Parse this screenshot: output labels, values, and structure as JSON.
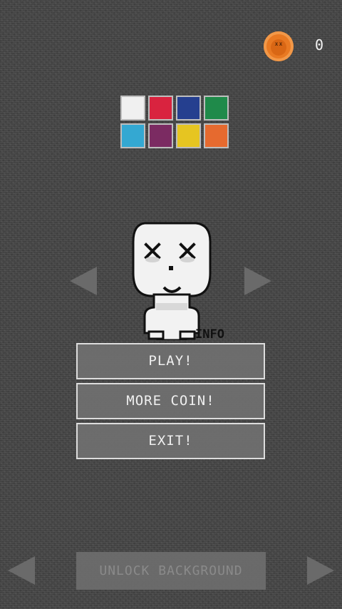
{
  "hud": {
    "coin_count": "0",
    "coin_icon": "coin-icon"
  },
  "palette": {
    "swatches": [
      {
        "color": "#f0f0f0"
      },
      {
        "color": "#d9233f"
      },
      {
        "color": "#253f8f"
      },
      {
        "color": "#1f8a4a"
      },
      {
        "color": "#34a8d2"
      },
      {
        "color": "#7b2b62"
      },
      {
        "color": "#e6c521"
      },
      {
        "color": "#e66a2f"
      }
    ]
  },
  "character": {
    "selector_left_icon": "arrow-left-icon",
    "selector_right_icon": "arrow-right-icon",
    "info_label": "INFO"
  },
  "menu": {
    "play_label": "PLAY!",
    "more_coin_label": "MORE COIN!",
    "exit_label": "EXIT!"
  },
  "background_selector": {
    "left_icon": "arrow-left-icon",
    "right_icon": "arrow-right-icon",
    "unlock_label": "UNLOCK BACKGROUND"
  },
  "colors": {
    "accent_coin": "#e97922",
    "button_fill": "#707070",
    "button_border": "#dddddd",
    "button_text": "#f0f0f0",
    "disabled_text": "#8a8a8a"
  }
}
